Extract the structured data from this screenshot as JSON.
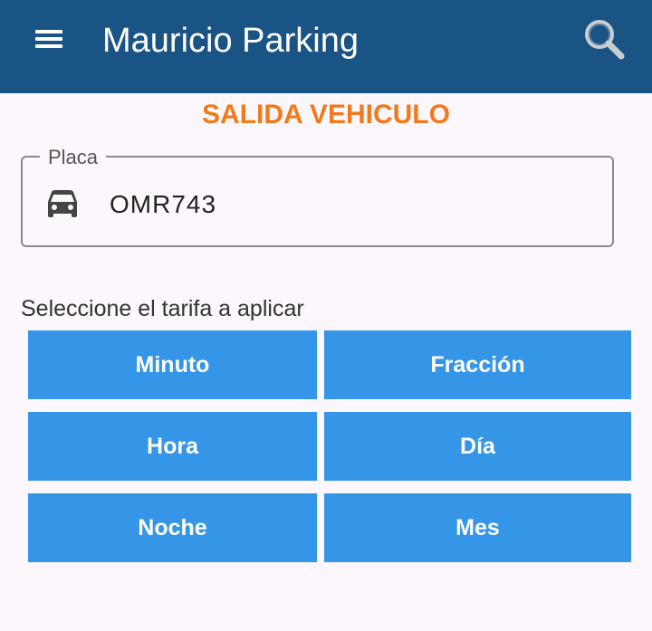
{
  "appbar": {
    "title": "Mauricio Parking",
    "menu_icon": "hamburger-menu-icon",
    "search_icon": "search-icon",
    "background_color": "#1a5485"
  },
  "page": {
    "section_title": "SALIDA VEHICULO",
    "section_title_color": "#f27a1a"
  },
  "plate_field": {
    "label": "Placa",
    "value": "OMR743",
    "icon": "car-icon"
  },
  "rates": {
    "prompt": "Seleccione el tarifa a aplicar",
    "button_color": "#3595e6",
    "options": [
      {
        "label": "Minuto"
      },
      {
        "label": "Fracción"
      },
      {
        "label": "Hora"
      },
      {
        "label": "Día"
      },
      {
        "label": "Noche"
      },
      {
        "label": "Mes"
      }
    ]
  }
}
